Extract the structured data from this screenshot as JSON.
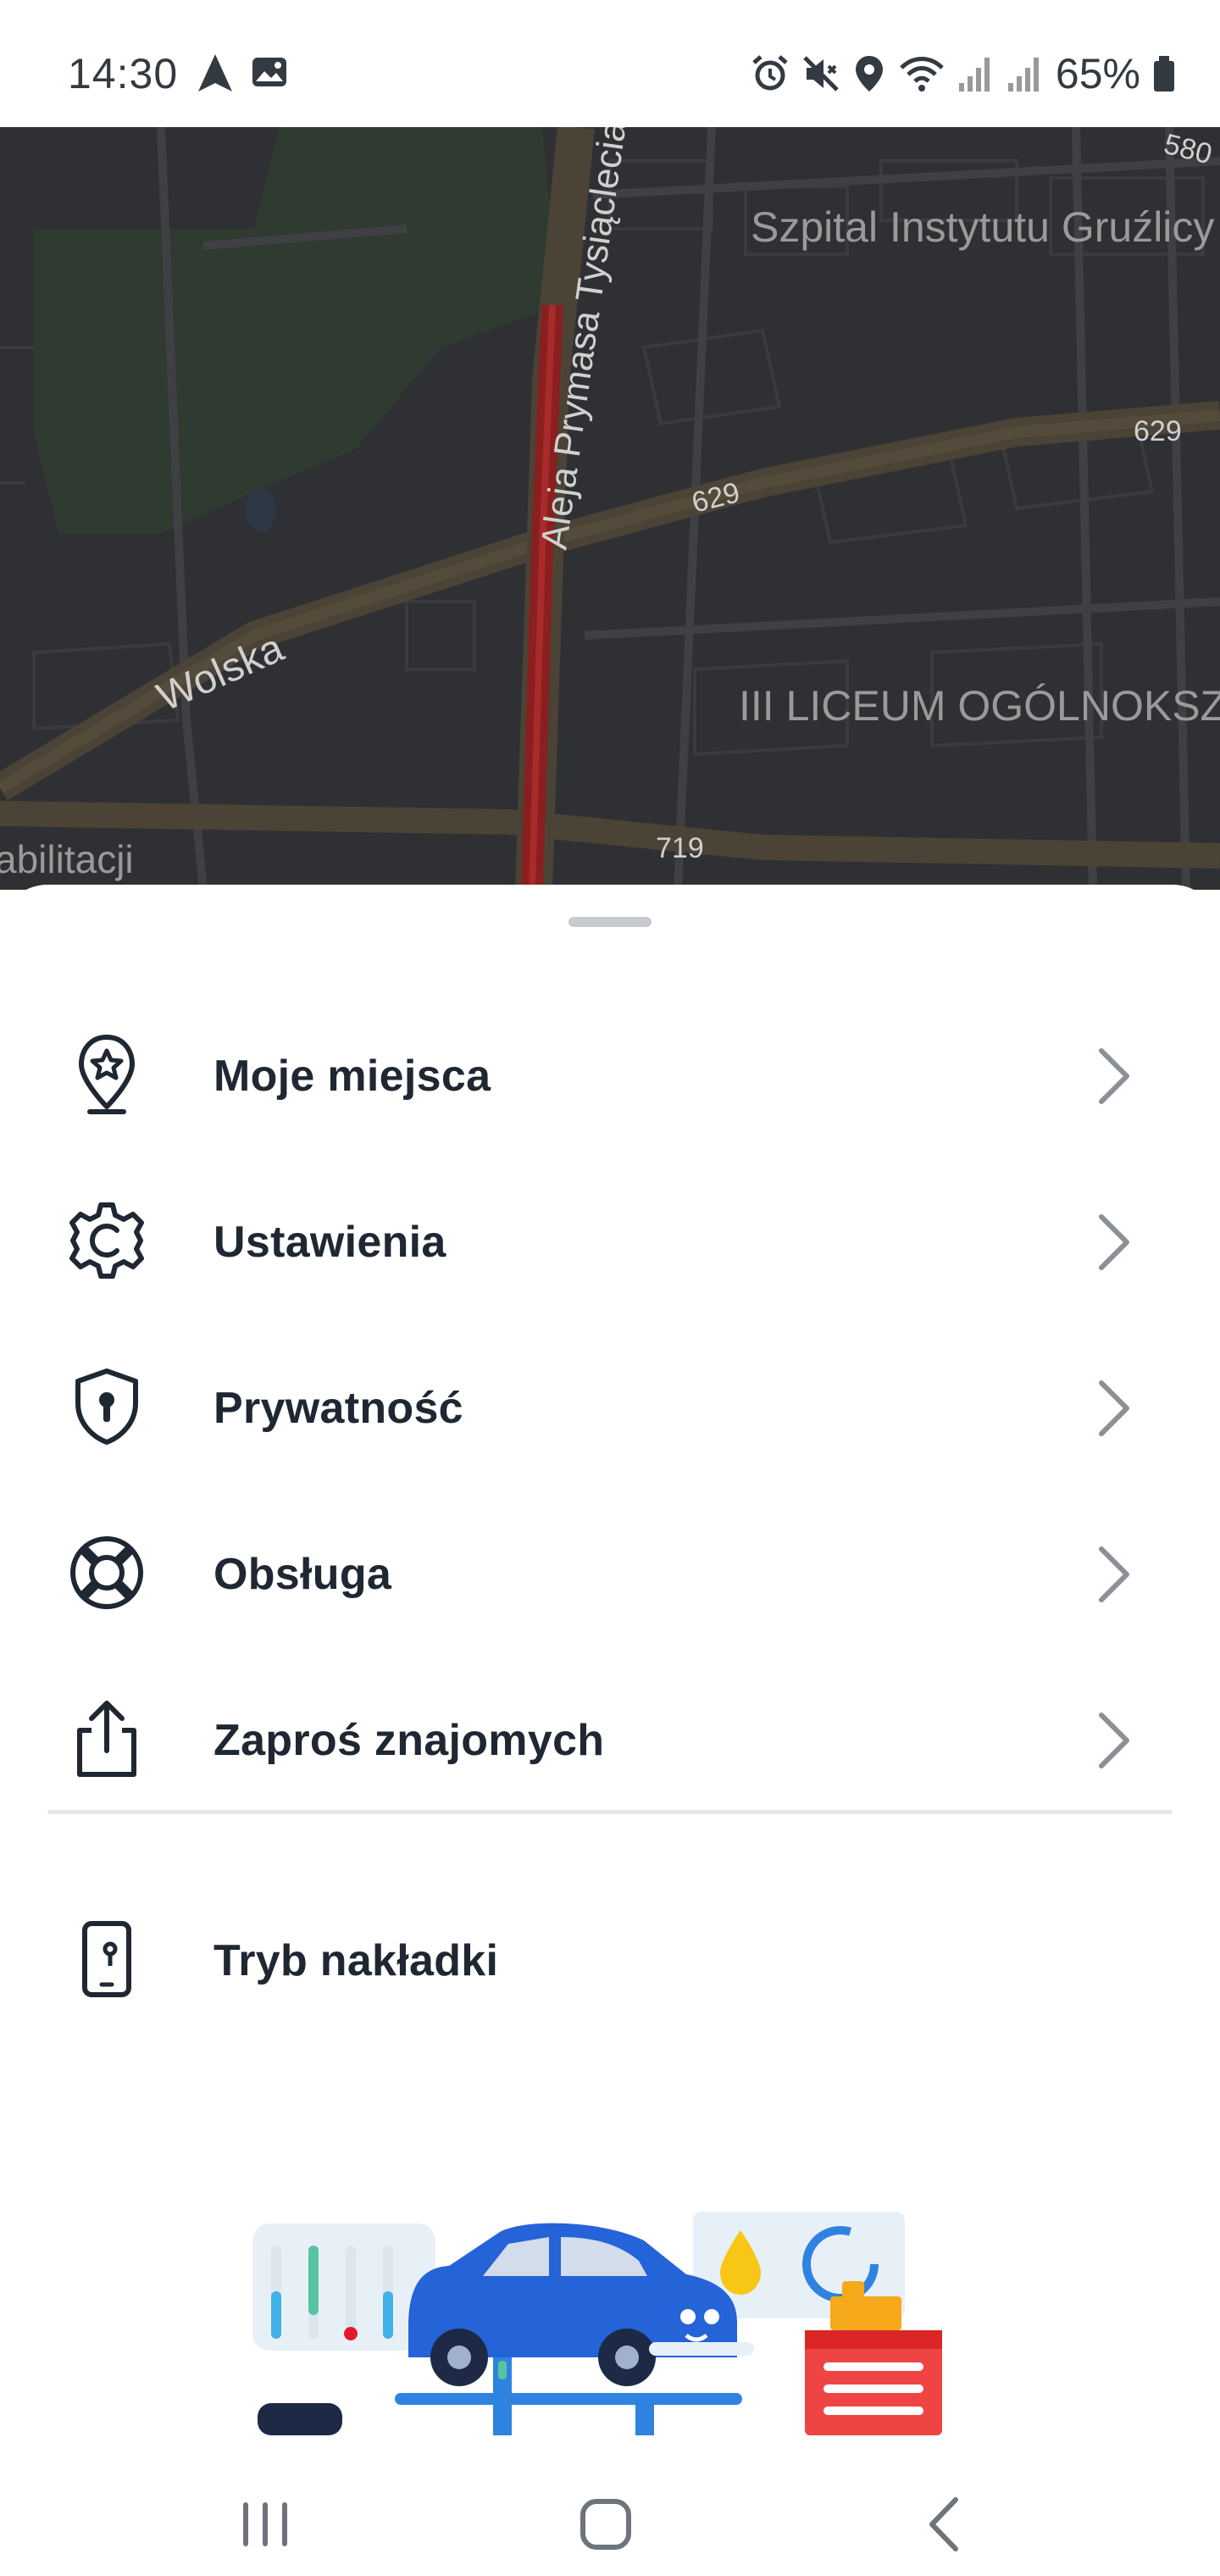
{
  "status_bar": {
    "time": "14:30",
    "battery_percent": "65%",
    "icons": [
      "navigation-icon",
      "gallery-icon",
      "alarm-icon",
      "vibrate-icon",
      "location-icon",
      "wifi-icon",
      "signal-icon",
      "signal-icon",
      "battery-icon"
    ]
  },
  "map": {
    "labels": {
      "hospital": "Szpital Instytutu Gruźlicy",
      "street_main": "Aleja Prymasa Tysiąclecia",
      "street_wolska": "Wolska",
      "road_629_a": "629",
      "road_629_b": "629",
      "road_719": "719",
      "road_580": "580",
      "school": "III LICEUM OGÓLNOKSZT",
      "rehab": "abilitacji"
    }
  },
  "menu": {
    "items": [
      {
        "label": "Moje miejsca",
        "icon": "place-pin-star-icon"
      },
      {
        "label": "Ustawienia",
        "icon": "gear-icon"
      },
      {
        "label": "Prywatność",
        "icon": "shield-lock-icon"
      },
      {
        "label": "Obsługa",
        "icon": "lifebuoy-icon"
      },
      {
        "label": "Zaproś znajomych",
        "icon": "share-icon"
      }
    ],
    "overlay_mode": {
      "label": "Tryb nakładki",
      "icon": "phone-overlay-icon"
    }
  },
  "colors": {
    "accent_blue": "#2563d8",
    "text_primary": "#1f2733",
    "chevron": "#8b9096",
    "map_bg": "#2f3033",
    "route_red": "#8a1f1f"
  },
  "illustration": {
    "subject": "car-service-illustration"
  },
  "nav_bar": {
    "buttons": [
      "recent-apps-icon",
      "home-icon",
      "back-icon"
    ]
  }
}
